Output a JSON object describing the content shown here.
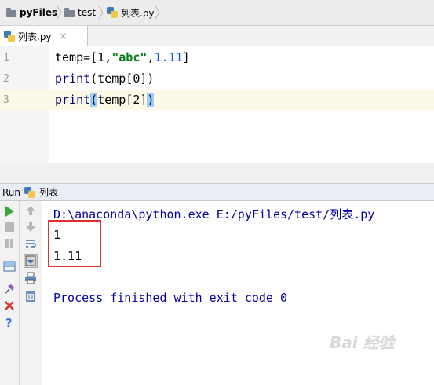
{
  "breadcrumb": {
    "project": "pyFiles",
    "folder": "test",
    "file": "列表.py"
  },
  "tab": {
    "label": "列表.py",
    "close": "×"
  },
  "editor": {
    "line_numbers": [
      "1",
      "2",
      "3"
    ],
    "lines": [
      {
        "p1": "temp=[1,",
        "str": "\"abc\"",
        "p2": ",",
        "n": "1.11",
        "p3": "]"
      },
      {
        "fn": "print",
        "rest": "(temp[0])"
      },
      {
        "fn": "print",
        "open": "(",
        "mid": "temp[2]",
        "close": ")"
      }
    ]
  },
  "run": {
    "label": "Run",
    "config": "列表"
  },
  "console": {
    "command": "D:\\anaconda\\python.exe E:/pyFiles/test/列表.py",
    "output": [
      "1",
      "1.11"
    ],
    "finish": "Process finished with exit code 0"
  },
  "watermark": "Bai 经验",
  "colors": {
    "accent_red": "#e03030",
    "console_blue": "#0000aa",
    "run_green": "#3aa53a"
  }
}
